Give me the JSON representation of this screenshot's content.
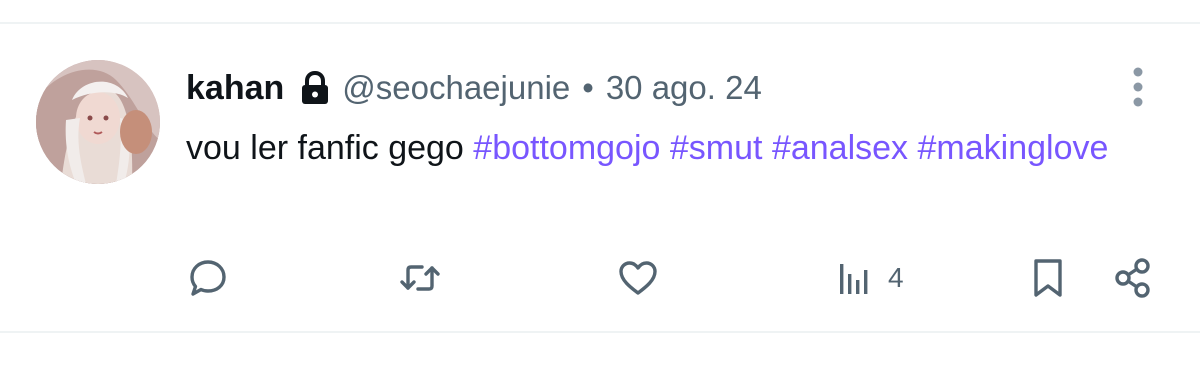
{
  "author": {
    "display_name": "kahan",
    "handle": "@seochaejunie",
    "separator": "•",
    "date": "30 ago. 24",
    "protected": true
  },
  "tweet": {
    "text_plain": "vou ler fanfic gego ",
    "hashtags": [
      "#bottomgojo",
      "#smut",
      "#analsex",
      "#makinglove"
    ]
  },
  "metrics": {
    "views": "4"
  },
  "colors": {
    "hashtag": "#7856ff",
    "secondary_text": "#536471",
    "primary_text": "#0f1419",
    "divider": "#eff3f4"
  },
  "icons": {
    "lock": "lock-icon",
    "more": "more-vertical-icon",
    "reply": "reply-icon",
    "retweet": "retweet-icon",
    "like": "heart-icon",
    "views": "views-chart-icon",
    "bookmark": "bookmark-icon",
    "share": "share-icon"
  }
}
